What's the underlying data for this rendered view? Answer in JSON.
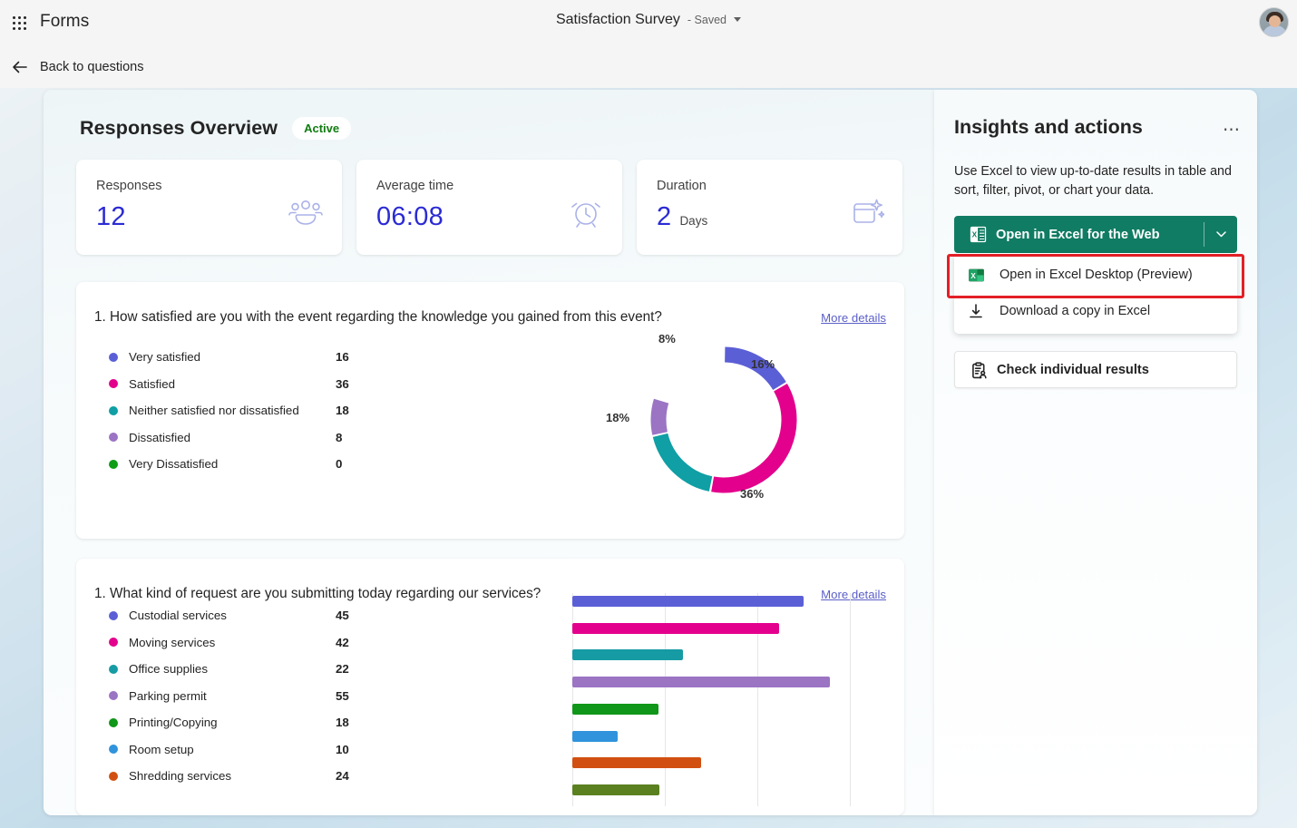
{
  "topbar": {
    "waffle_icon": "app-launcher-icon",
    "brand": "Forms",
    "doc_title": "Satisfaction Survey",
    "saved_status": "- Saved",
    "avatar_alt": "user-avatar"
  },
  "backbar": {
    "label": "Back to questions",
    "icon": "arrow-left-icon"
  },
  "overview": {
    "title": "Responses Overview",
    "status_badge": "Active",
    "stats": [
      {
        "label": "Responses",
        "value": "12",
        "unit": "",
        "icon": "people-icon"
      },
      {
        "label": "Average time",
        "value": "06:08",
        "unit": "",
        "icon": "clock-icon"
      },
      {
        "label": "Duration",
        "value": "2",
        "unit": "Days",
        "icon": "calendar-sparkle-icon"
      }
    ]
  },
  "questions": [
    {
      "text": "1. How satisfied are you with the event regarding the knowledge you gained from this event?",
      "more_details": "More details"
    },
    {
      "text": "1. What kind of request are you submitting today regarding our services?",
      "more_details": "More details"
    }
  ],
  "side": {
    "title": "Insights and actions",
    "more_icon": "ellipsis-icon",
    "description": "Use Excel to view up-to-date results in table and sort, filter, pivot, or chart your data.",
    "primary_button": {
      "label": "Open in Excel for the Web",
      "icon": "excel-icon",
      "chevron": "chevron-down-icon",
      "color": "#107c63"
    },
    "menu_items": [
      {
        "label": "Open in Excel Desktop (Preview)",
        "icon": "excel-icon",
        "highlighted": true
      },
      {
        "label": "Download a copy in Excel",
        "icon": "download-icon",
        "highlighted": false
      }
    ],
    "highlight_color": "#e31f26",
    "check_button": {
      "label": "Check individual results",
      "icon": "clipboard-person-icon"
    }
  },
  "chart_data": [
    {
      "type": "pie",
      "title": "1. How satisfied are you with the event regarding the knowledge you gained from this event?",
      "categories": [
        "Very satisfied",
        "Satisfied",
        "Neither satisfied nor dissatisfied",
        "Dissatisfied",
        "Very Dissatisfied"
      ],
      "values": [
        16,
        36,
        18,
        8,
        0
      ],
      "percent_labels": [
        "16%",
        "36%",
        "18%",
        "8%",
        ""
      ],
      "colors": [
        "#5b5fd6",
        "#e3008c",
        "#0f9fa5",
        "#9b74c4",
        "#0f9d16"
      ],
      "legend": "left",
      "donut": true
    },
    {
      "type": "bar",
      "orientation": "horizontal",
      "title": "1. What kind of request are you submitting today regarding our services?",
      "categories": [
        "Custodial services",
        "Moving services",
        "Office supplies",
        "Parking permit",
        "Printing/Copying",
        "Room setup",
        "Shredding services",
        ""
      ],
      "values": [
        45,
        42,
        22,
        55,
        18,
        10,
        24,
        22
      ],
      "colors": [
        "#5b5fd6",
        "#e3008c",
        "#169ba4",
        "#9b74c4",
        "#109618",
        "#3093dc",
        "#d15011",
        "#5a8020"
      ],
      "xlim": [
        0,
        75
      ],
      "grid": true,
      "legend": "left"
    }
  ]
}
